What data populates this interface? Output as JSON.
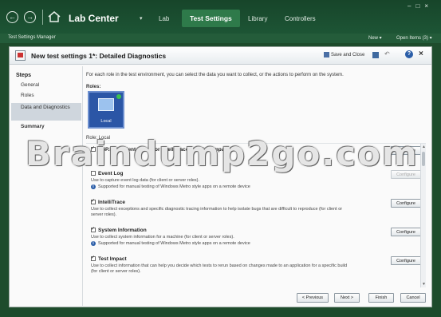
{
  "app": {
    "title": "Lab Center",
    "menu_dot": "▾",
    "tabs": [
      {
        "label": "Lab"
      },
      {
        "label": "Test Settings"
      },
      {
        "label": "Library"
      },
      {
        "label": "Controllers"
      }
    ],
    "window_controls": "–□×"
  },
  "subbar": {
    "title": "Test Settings Manager",
    "new_label": "New ▾",
    "open_label": "Open Items (3) ▾"
  },
  "window": {
    "title": "New test settings 1*: Detailed Diagnostics",
    "save_close": "Save and Close"
  },
  "steps": {
    "title": "Steps",
    "items": [
      "General",
      "Roles",
      "Data and Diagnostics",
      "Summary"
    ]
  },
  "content": {
    "intro": "For each role in the test environment, you can select the data you want to collect, or the actions to perform on the system.",
    "roles_label": "Roles:",
    "role_tile_label": "Local",
    "roles_sub": "Role: Local"
  },
  "adapters": [
    {
      "name": "ASP.NET Client Proxy for IntelliTrace and Test Impact",
      "checked": true,
      "desc": "",
      "note": "",
      "configure": "Configure",
      "enabled": true
    },
    {
      "name": "Event Log",
      "checked": false,
      "desc": "Use to capture event log data (for client or server roles).",
      "note": "Supported for manual testing of Windows Metro style apps on a remote device",
      "configure": "Configure",
      "enabled": false
    },
    {
      "name": "IntelliTrace",
      "checked": true,
      "desc": "Use to collect exceptions and specific diagnostic tracing information to help isolate bugs that are difficult to reproduce (for client or server roles).",
      "note": "",
      "configure": "Configure",
      "enabled": true
    },
    {
      "name": "System Information",
      "checked": true,
      "desc": "Use to collect system information for a machine (for client or server roles).",
      "note": "Supported for manual testing of Windows Metro style apps on a remote device",
      "configure": "Configure",
      "enabled": true
    },
    {
      "name": "Test Impact",
      "checked": true,
      "desc": "Use to collect information that can help you decide which tests to rerun based on changes made to an application for a specific build (for client or server roles).",
      "note": "",
      "configure": "Configure",
      "enabled": true
    }
  ],
  "footer": {
    "previous": "< Previous",
    "next": "Next >",
    "finish": "Finish",
    "cancel": "Cancel"
  },
  "watermark": "Braindump2go.com",
  "icons": [
    "back-icon",
    "forward-icon",
    "home-icon",
    "save-icon",
    "undo-icon",
    "help-icon",
    "close-icon",
    "info-icon"
  ],
  "colors": {
    "titlebar": "#1d5535",
    "active_tab": "#2e7a4a",
    "role_tile": "#2b56a6"
  }
}
